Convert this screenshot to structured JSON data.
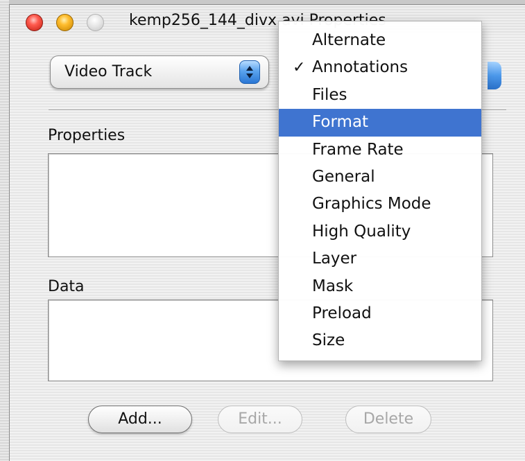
{
  "window": {
    "title": "kemp256_144_divx.avi Properties"
  },
  "track_popup": {
    "selected": "Video Track"
  },
  "sections": {
    "properties_label": "Properties",
    "data_label": "Data"
  },
  "buttons": {
    "add": "Add...",
    "edit": "Edit...",
    "delete": "Delete"
  },
  "menu": {
    "items": [
      {
        "label": "Alternate",
        "checked": false,
        "highlighted": false
      },
      {
        "label": "Annotations",
        "checked": true,
        "highlighted": false
      },
      {
        "label": "Files",
        "checked": false,
        "highlighted": false
      },
      {
        "label": "Format",
        "checked": false,
        "highlighted": true
      },
      {
        "label": "Frame Rate",
        "checked": false,
        "highlighted": false
      },
      {
        "label": "General",
        "checked": false,
        "highlighted": false
      },
      {
        "label": "Graphics Mode",
        "checked": false,
        "highlighted": false
      },
      {
        "label": "High Quality",
        "checked": false,
        "highlighted": false
      },
      {
        "label": "Layer",
        "checked": false,
        "highlighted": false
      },
      {
        "label": "Mask",
        "checked": false,
        "highlighted": false
      },
      {
        "label": "Preload",
        "checked": false,
        "highlighted": false
      },
      {
        "label": "Size",
        "checked": false,
        "highlighted": false
      }
    ],
    "check_glyph": "✓",
    "highlight_color": "#3f74d0"
  }
}
